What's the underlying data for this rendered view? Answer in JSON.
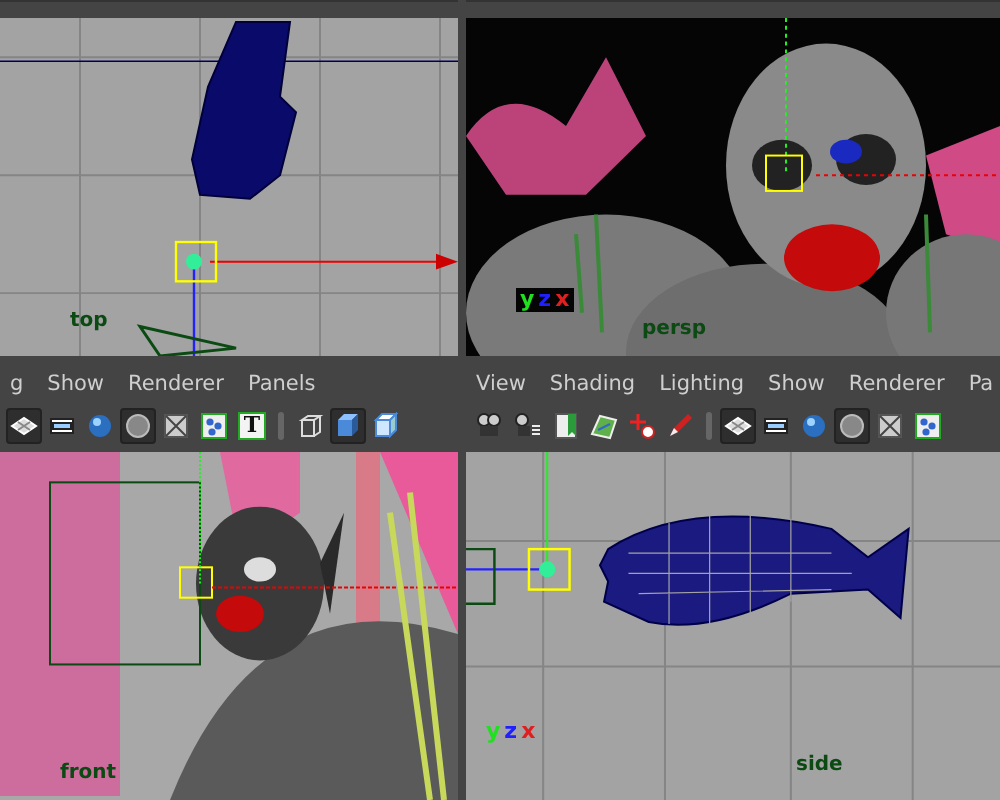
{
  "viewports": [
    {
      "label": "top",
      "kind": "top-wire"
    },
    {
      "label": "persp",
      "kind": "render-persp",
      "axes": [
        {
          "letter": "y",
          "color": "#20e020"
        },
        {
          "letter": "z",
          "color": "#2020ff"
        },
        {
          "letter": "x",
          "color": "#e02020"
        }
      ]
    },
    {
      "label": "front",
      "kind": "render-front",
      "menu": [
        "g",
        "Show",
        "Renderer",
        "Panels"
      ],
      "toolbar": [
        {
          "kind": "grid",
          "selected": true
        },
        {
          "kind": "film",
          "selected": false
        },
        {
          "kind": "sphere",
          "selected": false
        },
        {
          "kind": "flat-sphere",
          "selected": true
        },
        {
          "kind": "xray",
          "selected": false
        },
        {
          "kind": "nodes",
          "selected": false
        },
        {
          "kind": "text",
          "glyph": "T",
          "selected": false
        },
        {
          "kind": "sep"
        },
        {
          "kind": "cube-wire",
          "selected": false
        },
        {
          "kind": "cube-solid",
          "selected": true
        },
        {
          "kind": "cube-light",
          "selected": false
        }
      ]
    },
    {
      "label": "side",
      "kind": "side-wire",
      "axes": [
        {
          "letter": "y",
          "color": "#20e020"
        },
        {
          "letter": "z",
          "color": "#2020ff"
        },
        {
          "letter": "x",
          "color": "#e02020"
        }
      ],
      "menu": [
        "View",
        "Shading",
        "Lighting",
        "Show",
        "Renderer",
        "Pa"
      ],
      "toolbar": [
        {
          "kind": "camera",
          "selected": false
        },
        {
          "kind": "camera-list",
          "selected": false
        },
        {
          "kind": "bookmark",
          "selected": false
        },
        {
          "kind": "image-plane",
          "selected": false
        },
        {
          "kind": "select-tool",
          "selected": false
        },
        {
          "kind": "pencil",
          "selected": false
        },
        {
          "kind": "sep"
        },
        {
          "kind": "grid",
          "selected": true
        },
        {
          "kind": "film",
          "selected": false
        },
        {
          "kind": "sphere",
          "selected": false
        },
        {
          "kind": "flat-sphere",
          "selected": true
        },
        {
          "kind": "xray",
          "selected": false
        },
        {
          "kind": "nodes",
          "selected": false
        }
      ]
    }
  ]
}
